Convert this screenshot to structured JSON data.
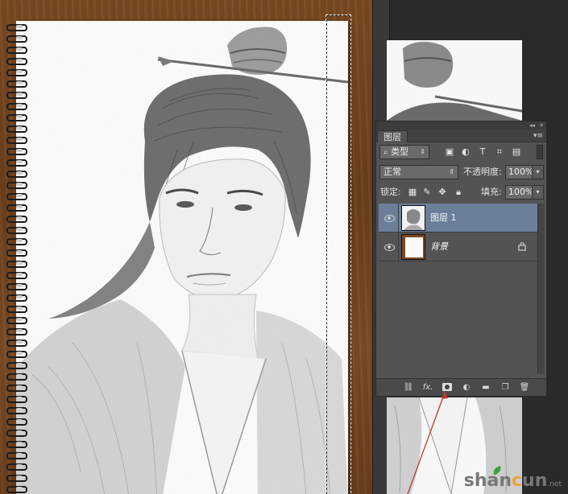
{
  "panel": {
    "tab_title": "图层",
    "tab_menu_icon": "panel-menu-icon",
    "collapse_icon": "collapse-icon",
    "close_icon": "close-icon",
    "filter": {
      "label": "类型",
      "icon": "search-icon"
    },
    "filter_icons": [
      "pixel-filter-icon",
      "adjustment-filter-icon",
      "type-filter-icon",
      "shape-filter-icon",
      "smart-object-filter-icon"
    ],
    "blend_mode": "正常",
    "opacity_label": "不透明度:",
    "opacity_value": "100%",
    "lock_label": "锁定:",
    "lock_icons": [
      "lock-transparent-icon",
      "lock-image-icon",
      "lock-position-icon",
      "lock-all-icon"
    ],
    "fill_label": "填充:",
    "fill_value": "100%",
    "layers": [
      {
        "name": "图层 1",
        "selected": true,
        "visible": true,
        "locked": false
      },
      {
        "name": "背景",
        "selected": false,
        "visible": true,
        "locked": true
      }
    ],
    "footer_icons": [
      "link-layers-icon",
      "fx-icon",
      "layer-mask-icon",
      "adjustment-layer-icon",
      "group-icon",
      "new-layer-icon",
      "trash-icon"
    ],
    "fx_label": "fx."
  },
  "colors": {
    "selected_layer": "#6b7f9a",
    "panel_bg": "#535353",
    "wood": "#6b3f1b",
    "arrow": "#c0392b"
  },
  "watermark": {
    "prefix": "shan",
    "accent": "c",
    "suffix": "un",
    "tld": ".net"
  }
}
